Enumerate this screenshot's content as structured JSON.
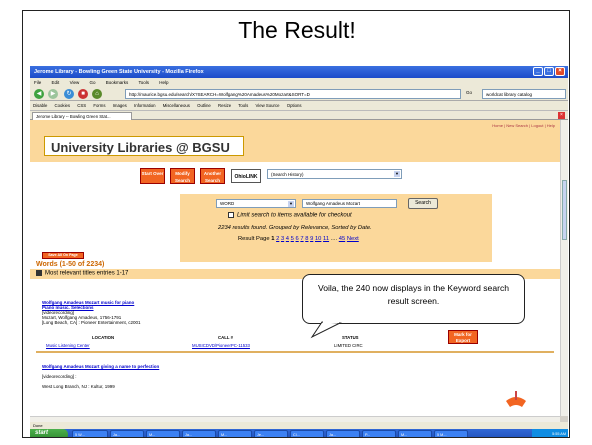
{
  "slide": {
    "title": "The Result!",
    "callout": "Voila, the 240 now displays in the Keyword search result screen."
  },
  "window": {
    "title": "Jerome Library - Bowling Green State University - Mozilla Firefox",
    "menu": [
      "File",
      "Edit",
      "View",
      "Go",
      "Bookmarks",
      "Tools",
      "Help"
    ],
    "url": "http://maurice.bgsu.edu/search/X?SEARCH=Wolfgang%20Amadeus%20Mozart&SORT=D",
    "go_label": "Go",
    "search_engine": "worldcat library catalog",
    "toolbar": [
      "Disable",
      "Cookies",
      "CSS",
      "Forms",
      "Images",
      "Information",
      "Miscellaneous",
      "Outline",
      "Resize",
      "Tools",
      "View Source",
      "Options"
    ],
    "tab_label": "Jerome Library -- Bowling Green Stat..."
  },
  "page": {
    "header_links": "Home | New Search | Logout | Help",
    "header_title": "University Libraries @ BGSU",
    "buttons": {
      "start_over": "Start Over",
      "modify_search": "Modify Search",
      "another_search": "Another Search",
      "ohiolink": "OhioLINK",
      "search_history": "(Search History)"
    },
    "search": {
      "type": "WORD",
      "query": "Wolfgang Amadeus Mozart",
      "button": "Search",
      "limit": "Limit search to items available for checkout",
      "found": "2234 results found. Grouped by Relevance, Sorted by Date.",
      "result_page_label": "Result Page",
      "current_page": "1",
      "pages": [
        "2",
        "3",
        "4",
        "5",
        "6",
        "7",
        "8",
        "9",
        "10",
        "11"
      ],
      "ellipsis": "....",
      "last_page": "45",
      "next": "Next"
    },
    "save_list": "Save All On Page",
    "words_line": "Words (1-50 of 2234)",
    "most_relevant": "Most relevant titles entries 1-17",
    "result1": {
      "title_line1": "Wolfgang Amadeus Mozart music for piano",
      "title_line2": "Piano music. Selections",
      "format": "[videorecording]",
      "author": "Mozart, Wolfgang Amadeus, 1756-1791",
      "publisher": "[Long Beach, CA] : Pioneer Entertainment, c2001",
      "headers": [
        "LOCATION",
        "CALL #",
        "STATUS"
      ],
      "location": "Music Listening Center",
      "call": "MUSICDVD/PioneerPC-11533",
      "status": "LIMITED CIRC",
      "export": "Mark for Export"
    },
    "result2": {
      "title": "Wolfgang Amadeus Mozart giving a name to perfection",
      "format": "[videorecording] :",
      "publisher": "West Long Branch, NJ : Kultur, 1999"
    }
  },
  "statusbar": "Done",
  "taskbar": {
    "start": "start",
    "tasks": [
      "5 W...",
      "Ja...",
      "M...",
      "Ja...",
      "M...",
      "Je...",
      "Cl...",
      "Ja...",
      "P...",
      "M...",
      "5 M..."
    ],
    "clock": "5:55 AM"
  }
}
